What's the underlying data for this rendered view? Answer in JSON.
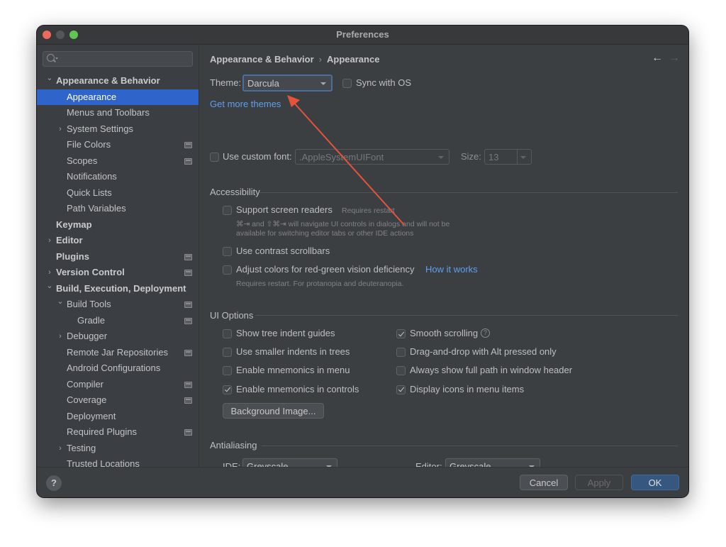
{
  "window": {
    "title": "Preferences"
  },
  "sidebar": {
    "search_placeholder": "",
    "items": [
      {
        "label": "Appearance & Behavior",
        "level": 0,
        "bold": true,
        "expander": "expanded"
      },
      {
        "label": "Appearance",
        "level": 1,
        "selected": true
      },
      {
        "label": "Menus and Toolbars",
        "level": 1
      },
      {
        "label": "System Settings",
        "level": 1,
        "expander": "collapsed"
      },
      {
        "label": "File Colors",
        "level": 1,
        "project_icon": true
      },
      {
        "label": "Scopes",
        "level": 1,
        "project_icon": true
      },
      {
        "label": "Notifications",
        "level": 1
      },
      {
        "label": "Quick Lists",
        "level": 1
      },
      {
        "label": "Path Variables",
        "level": 1
      },
      {
        "label": "Keymap",
        "level": 0,
        "bold": true
      },
      {
        "label": "Editor",
        "level": 0,
        "bold": true,
        "expander": "collapsed"
      },
      {
        "label": "Plugins",
        "level": 0,
        "bold": true,
        "project_icon": true
      },
      {
        "label": "Version Control",
        "level": 0,
        "bold": true,
        "expander": "collapsed",
        "project_icon": true
      },
      {
        "label": "Build, Execution, Deployment",
        "level": 0,
        "bold": true,
        "expander": "expanded"
      },
      {
        "label": "Build Tools",
        "level": 1,
        "expander": "expanded",
        "project_icon": true
      },
      {
        "label": "Gradle",
        "level": 2,
        "project_icon": true
      },
      {
        "label": "Debugger",
        "level": 1,
        "expander": "collapsed"
      },
      {
        "label": "Remote Jar Repositories",
        "level": 1,
        "project_icon": true
      },
      {
        "label": "Android Configurations",
        "level": 1
      },
      {
        "label": "Compiler",
        "level": 1,
        "project_icon": true
      },
      {
        "label": "Coverage",
        "level": 1,
        "project_icon": true
      },
      {
        "label": "Deployment",
        "level": 1
      },
      {
        "label": "Required Plugins",
        "level": 1,
        "project_icon": true
      },
      {
        "label": "Testing",
        "level": 1,
        "expander": "collapsed"
      },
      {
        "label": "Trusted Locations",
        "level": 1
      }
    ]
  },
  "breadcrumb": {
    "parent": "Appearance & Behavior",
    "separator": "›",
    "current": "Appearance"
  },
  "nav": {
    "back_icon": "←",
    "forward_icon": "→"
  },
  "theme": {
    "label": "Theme:",
    "value": "Darcula",
    "sync_label": "Sync with OS",
    "sync_checked": false,
    "get_more_link": "Get more themes"
  },
  "custom_font": {
    "label": "Use custom font:",
    "checked": false,
    "font_value": ".AppleSystemUIFont",
    "size_label": "Size:",
    "size_value": "13"
  },
  "accessibility": {
    "title": "Accessibility",
    "screen_readers": {
      "label": "Support screen readers",
      "checked": false,
      "note": "Requires restart",
      "hint_line1": "⌘⇥ and ⇧⌘⇥ will navigate UI controls in dialogs and will not be",
      "hint_line2": "available for switching editor tabs or other IDE actions"
    },
    "contrast_scrollbars": {
      "label": "Use contrast scrollbars",
      "checked": false
    },
    "color_deficiency": {
      "label": "Adjust colors for red-green vision deficiency",
      "checked": false,
      "link": "How it works",
      "hint": "Requires restart. For protanopia and deuteranopia."
    }
  },
  "ui_options": {
    "title": "UI Options",
    "left": [
      {
        "label": "Show tree indent guides",
        "checked": false
      },
      {
        "label": "Use smaller indents in trees",
        "checked": false
      },
      {
        "label": "Enable mnemonics in menu",
        "checked": false
      },
      {
        "label": "Enable mnemonics in controls",
        "checked": true
      }
    ],
    "right": [
      {
        "label": "Smooth scrolling",
        "checked": true,
        "help": "?"
      },
      {
        "label": "Drag-and-drop with Alt pressed only",
        "checked": false
      },
      {
        "label": "Always show full path in window header",
        "checked": false
      },
      {
        "label": "Display icons in menu items",
        "checked": true
      }
    ],
    "background_image_button": "Background Image..."
  },
  "antialiasing": {
    "title": "Antialiasing",
    "ide_label": "IDE:",
    "ide_value": "Greyscale",
    "editor_label": "Editor:",
    "editor_value": "Greyscale"
  },
  "footer": {
    "help_label": "?",
    "cancel": "Cancel",
    "apply": "Apply",
    "ok": "OK"
  },
  "colors": {
    "selection": "#2f65ca",
    "link": "#5e9fef",
    "primary_button": "#365880",
    "annotation_arrow": "#e5533b"
  }
}
